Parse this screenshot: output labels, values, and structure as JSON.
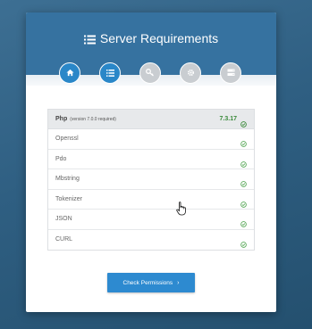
{
  "header": {
    "title": "Server Requirements"
  },
  "steps": [
    {
      "icon": "home-icon",
      "state": "active"
    },
    {
      "icon": "list-icon",
      "state": "active"
    },
    {
      "icon": "key-icon",
      "state": "inactive"
    },
    {
      "icon": "gear-icon",
      "state": "inactive"
    },
    {
      "icon": "server-icon",
      "state": "inactive"
    }
  ],
  "requirements": {
    "main": {
      "name": "Php",
      "note": "(version 7.0.0 required)",
      "version": "7.3.17"
    },
    "extensions": [
      {
        "name": "Openssl"
      },
      {
        "name": "Pdo"
      },
      {
        "name": "Mbstring"
      },
      {
        "name": "Tokenizer"
      },
      {
        "name": "JSON"
      },
      {
        "name": "CURL"
      }
    ]
  },
  "actions": {
    "check_permissions_label": "Check Permissions",
    "chevron": "›"
  },
  "colors": {
    "header": "#3672a0",
    "active_step": "#2a87c8",
    "inactive_step": "#c9cdd1",
    "ok": "#3a8a3a",
    "button": "#2d8ad0"
  }
}
